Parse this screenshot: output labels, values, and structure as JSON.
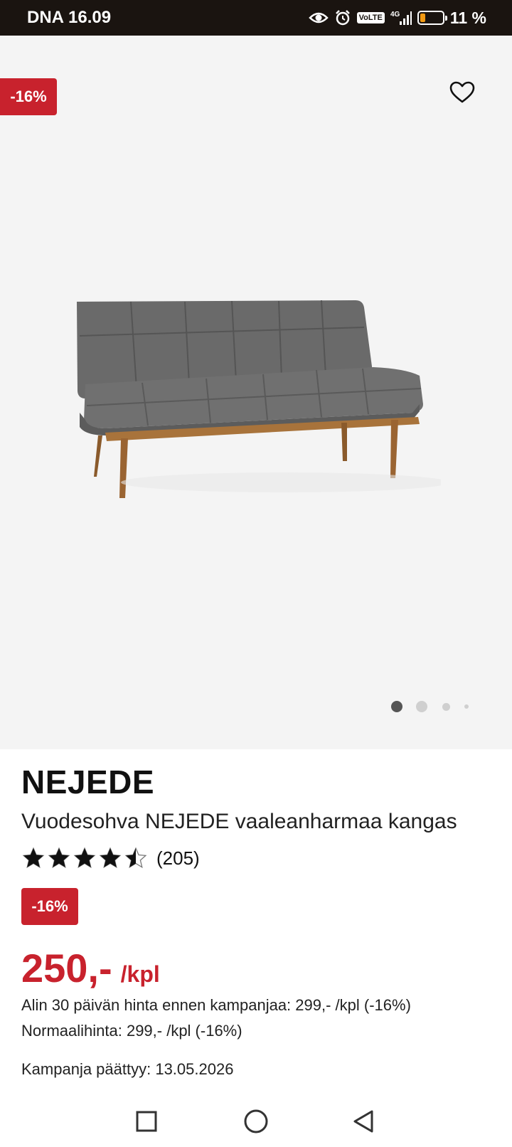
{
  "status_bar": {
    "carrier": "DNA",
    "time": "16.09",
    "network": "4G",
    "volte_label": "VoLTE",
    "battery": "11 %",
    "battery_level": 0.11
  },
  "gallery": {
    "badge": "-16%",
    "image_index": 1,
    "image_count": 4
  },
  "product": {
    "brand": "NEJEDE",
    "name": "Vuodesohva NEJEDE vaaleanharmaa kangas",
    "rating": 4.5,
    "review_count": "(205)",
    "discount_badge": "-16%",
    "price": "250,-",
    "unit": "/kpl",
    "lowest_price_text": "Alin 30 päivän hinta ennen kampanjaa: 299,- /kpl (-16%)",
    "normal_price_text": "Normaalihinta: 299,- /kpl (-16%)",
    "campaign_end_text": "Kampanja päättyy: 13.05.2026"
  },
  "colors": {
    "accent_red": "#c8222d",
    "status_bar_bg": "#1a1410",
    "gallery_bg": "#f4f4f4",
    "battery_orange": "#f29a13"
  },
  "nav": {
    "icons": [
      "recents-square-icon",
      "home-circle-icon",
      "back-triangle-icon"
    ]
  }
}
